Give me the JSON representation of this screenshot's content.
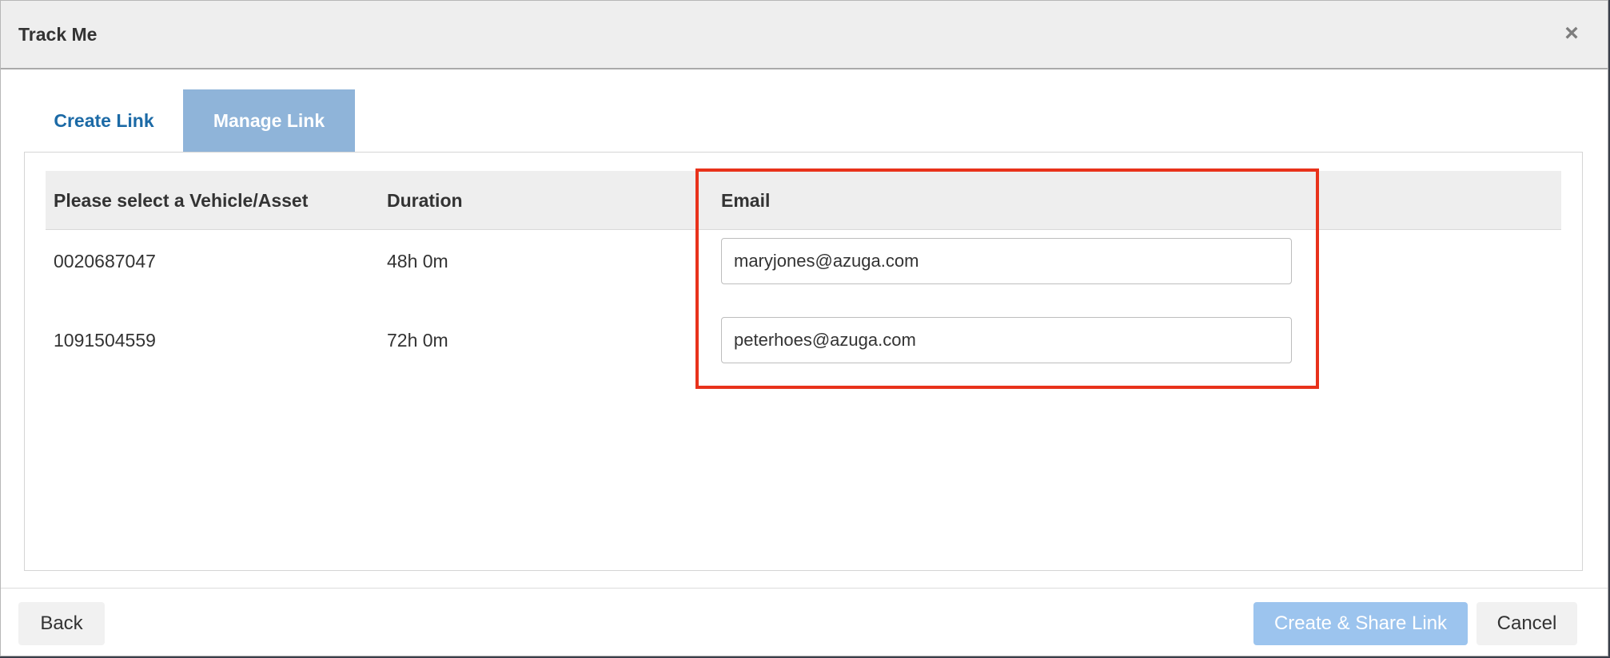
{
  "dialog": {
    "title": "Track Me",
    "close_icon": "close-icon"
  },
  "tabs": [
    {
      "label": "Create Link",
      "active": false
    },
    {
      "label": "Manage Link",
      "active": true
    }
  ],
  "table": {
    "columns": [
      "Please select a Vehicle/Asset",
      "Duration",
      "Email"
    ],
    "rows": [
      {
        "vehicle": "0020687047",
        "duration": "48h 0m",
        "email": "maryjones@azuga.com"
      },
      {
        "vehicle": "1091504559",
        "duration": "72h 0m",
        "email": "peterhoes@azuga.com"
      }
    ]
  },
  "footer": {
    "back_label": "Back",
    "create_label": "Create & Share Link",
    "cancel_label": "Cancel"
  },
  "colors": {
    "accent": "#1c6aa6",
    "active_tab": "#8fb4d9",
    "primary_button_disabled": "#9cc4ee",
    "highlight": "#e8321b"
  }
}
